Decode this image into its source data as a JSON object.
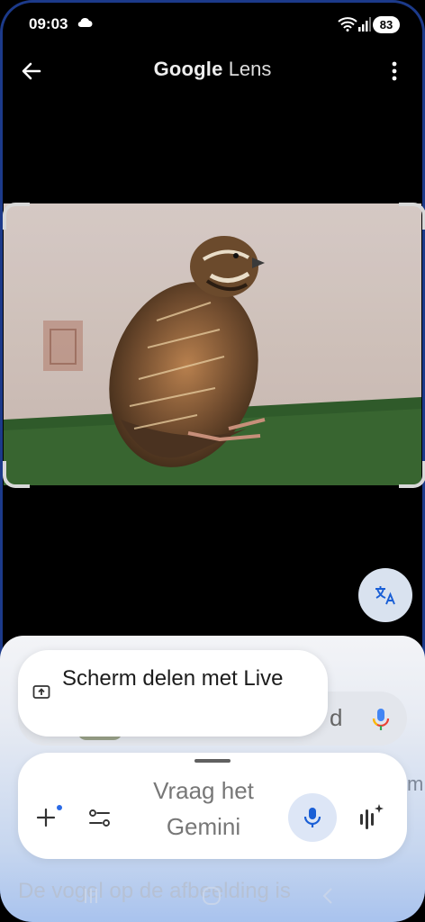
{
  "status_bar": {
    "time": "09:03",
    "battery": "83",
    "icons": [
      "cloud-icon",
      "wifi-icon",
      "signal-icon"
    ]
  },
  "top_bar": {
    "title_google": "Google",
    "title_lens": "Lens",
    "back_icon": "arrow-left-icon",
    "menu_icon": "more-vert-icon"
  },
  "image": {
    "description_icon": "quail-photo"
  },
  "translate_button": {
    "icon": "translate-icon"
  },
  "sheet": {
    "background_search_suffix": "d",
    "background_suggestion": "De vogel op de afbeelding is",
    "background_right_text": "m"
  },
  "share_popup": {
    "label": "Scherm delen met Live",
    "icon": "screen-share-icon"
  },
  "gemini_bar": {
    "placeholder": "Vraag het Gemini",
    "add_icon": "plus-icon",
    "tools_icon": "tune-icon",
    "mic_icon": "mic-icon",
    "live_icon": "gemini-live-icon"
  },
  "colors": {
    "accent_blue": "#1a5fd6",
    "sheet_top": "#f3f4f7",
    "sheet_bottom": "#a9c3ee"
  }
}
